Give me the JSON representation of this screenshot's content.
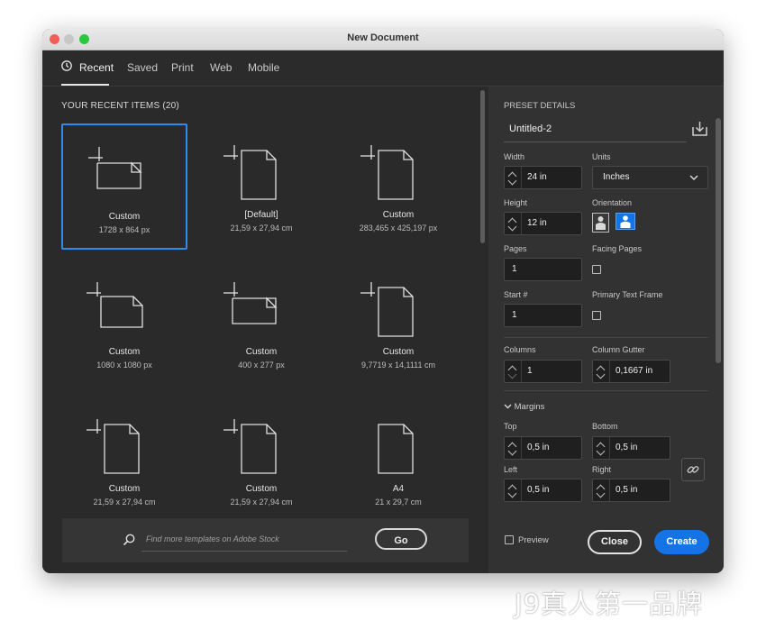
{
  "window": {
    "title": "New Document"
  },
  "tabs": [
    {
      "label": "Recent",
      "active": true
    },
    {
      "label": "Saved"
    },
    {
      "label": "Print"
    },
    {
      "label": "Web"
    },
    {
      "label": "Mobile"
    }
  ],
  "recent": {
    "heading": "YOUR RECENT ITEMS",
    "count": "(20)",
    "items": [
      {
        "name": "Custom",
        "size": "1728 x 864 px",
        "icon": "landscape-doc-icon"
      },
      {
        "name": "[Default]",
        "size": "21,59 x 27,94 cm",
        "icon": "portrait-doc-icon"
      },
      {
        "name": "Custom",
        "size": "283,465 x 425,197 px",
        "icon": "portrait-doc-icon"
      },
      {
        "name": "Custom",
        "size": "1080 x 1080 px",
        "icon": "square-doc-icon"
      },
      {
        "name": "Custom",
        "size": "400 x 277 px",
        "icon": "landscape-doc-icon"
      },
      {
        "name": "Custom",
        "size": "9,7719 x 14,1111 cm",
        "icon": "portrait-doc-icon"
      },
      {
        "name": "Custom",
        "size": "21,59 x 27,94 cm",
        "icon": "portrait-doc-icon"
      },
      {
        "name": "Custom",
        "size": "21,59 x 27,94 cm",
        "icon": "portrait-doc-icon"
      },
      {
        "name": "A4",
        "size": "21 x 29,7 cm",
        "icon": "portrait-doc-icon"
      }
    ]
  },
  "footer": {
    "search_placeholder": "Find more templates on Adobe Stock",
    "go_label": "Go"
  },
  "preset": {
    "heading": "PRESET DETAILS",
    "name": "Untitled-2",
    "width_label": "Width",
    "width_value": "24 in",
    "units_label": "Units",
    "units_value": "Inches",
    "height_label": "Height",
    "height_value": "12 in",
    "orientation_label": "Orientation",
    "pages_label": "Pages",
    "pages_value": "1",
    "facing_pages_label": "Facing Pages",
    "start_label": "Start #",
    "start_value": "1",
    "primary_text_frame_label": "Primary Text Frame",
    "columns_label": "Columns",
    "columns_value": "1",
    "gutter_label": "Column Gutter",
    "gutter_value": "0,1667 in",
    "margins_label": "Margins",
    "top_label": "Top",
    "top_value": "0,5 in",
    "bottom_label": "Bottom",
    "bottom_value": "0,5 in",
    "left_label": "Left",
    "left_value": "0,5 in",
    "right_label": "Right",
    "right_value": "0,5 in",
    "preview_label": "Preview",
    "close_label": "Close",
    "create_label": "Create"
  },
  "watermark": "J9真人第一品牌",
  "colors": {
    "accent": "#1473e6",
    "selection": "#2d8cf0",
    "background": "#2a2a2a"
  }
}
